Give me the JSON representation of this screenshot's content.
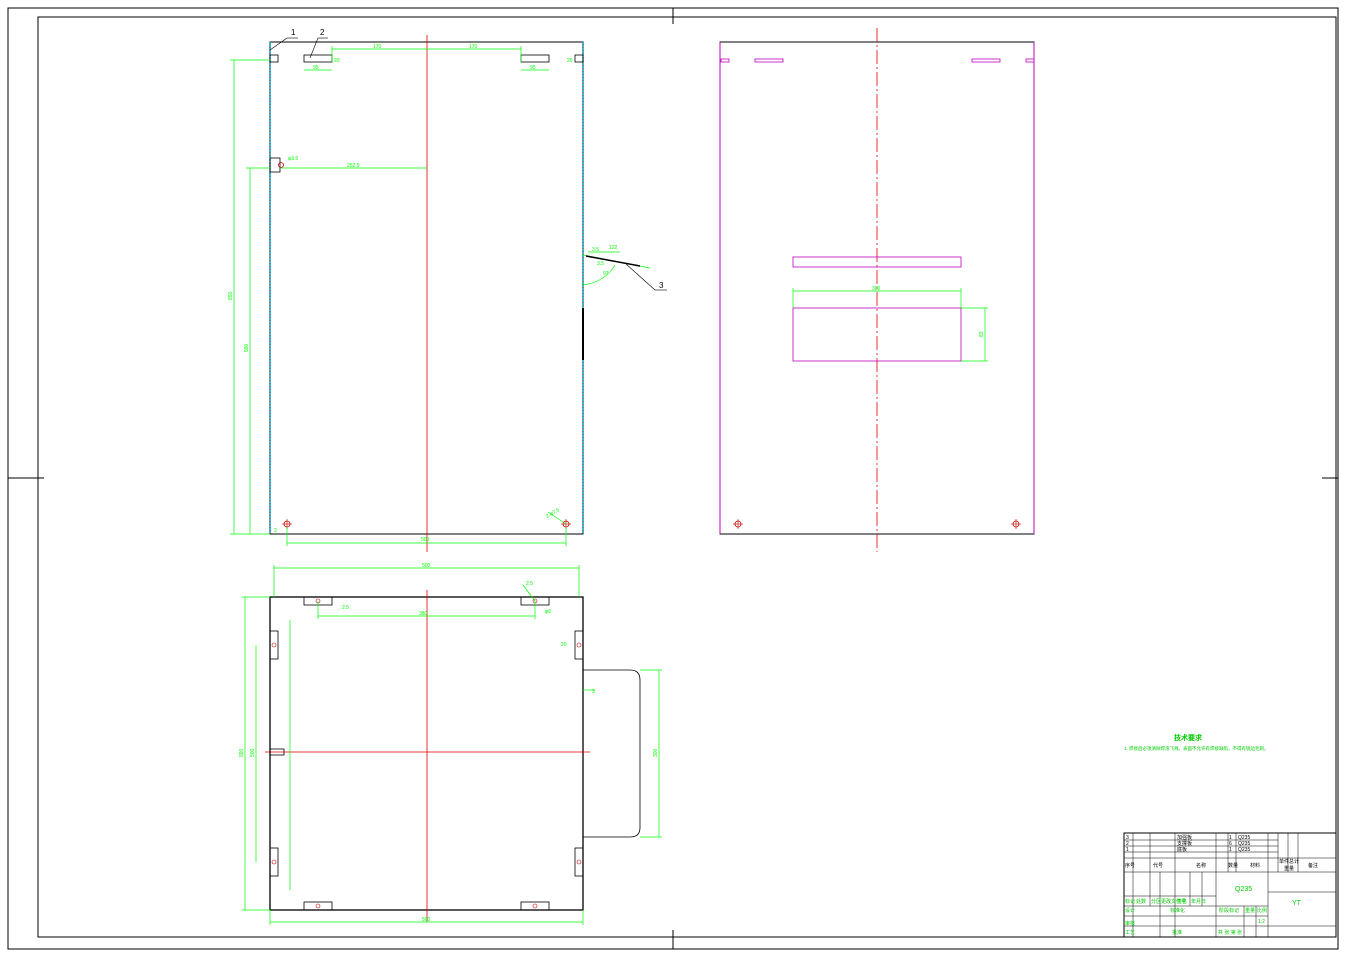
{
  "sheet": {
    "line_colors": {
      "outline": "#000000",
      "dimension": "#00ff00",
      "centerline": "#e00000",
      "hidden": "#00a0c0",
      "cutout": "#c000c0"
    }
  },
  "front_view": {
    "balloons": [
      {
        "id": "b1",
        "text": "1"
      },
      {
        "id": "b2",
        "text": "2"
      },
      {
        "id": "b3",
        "text": "3"
      }
    ],
    "dims": {
      "top_left_170": "170",
      "top_right_170": "170",
      "slot_left": "95",
      "slot_left_small": "20",
      "slot_right": "95",
      "slot_right_small": "20",
      "hole_dia": "φ3.5",
      "horiz_252": "252.9",
      "height_total": "850",
      "height_mid": "590",
      "width_bottom": "500",
      "hole_bottom": "2-φ7.5",
      "side_a": "3.5",
      "side_b": "122",
      "side_c": "3.5",
      "angle": "97",
      "small_bottom": "3"
    }
  },
  "right_view": {
    "dims": {
      "rect_width": "300",
      "rect_height": "83"
    }
  },
  "bottom_view": {
    "dims": {
      "top_width": "500",
      "top_small": "2.5",
      "inner_width": "380",
      "hole_left": "2.5",
      "hole_right": "φ6",
      "side_small_top": "20",
      "side_small_2": "3",
      "left_height": "590",
      "left_inner": "500",
      "right_height": "300",
      "bottom_width": "500"
    }
  },
  "notes": {
    "title": "技术要求",
    "line1": "1. 焊接后必须清除焊渣飞溅，表面不允许有焊接缺陷，不得有锐边毛刺。"
  },
  "title_block": {
    "parts": [
      {
        "no": "3",
        "name": "加强板",
        "qty": "1",
        "material": "Q235"
      },
      {
        "no": "2",
        "name": "支撑板",
        "qty": "6",
        "material": "Q235"
      },
      {
        "no": "1",
        "name": "底板",
        "qty": "1",
        "material": "Q235"
      }
    ],
    "headers": {
      "no": "序号",
      "code": "代号",
      "name": "名称",
      "qty": "数量",
      "material": "材料",
      "single": "单件",
      "total": "总计",
      "weight": "重量",
      "remark": "备注"
    },
    "material_label": "Q235",
    "drawing_code": "YT",
    "row_labels": {
      "mark": "标记",
      "count": "处数",
      "zone": "分区",
      "change_doc": "更改文件号",
      "sign": "签名",
      "date": "年月日",
      "design": "设计",
      "standard": "标准化",
      "stage_mark": "阶段标记",
      "weight": "重量",
      "scale": "比例",
      "check": "审核",
      "process": "工艺",
      "approve": "批准",
      "sheets": "共  张  第  张",
      "scale_value": "1:2"
    }
  }
}
